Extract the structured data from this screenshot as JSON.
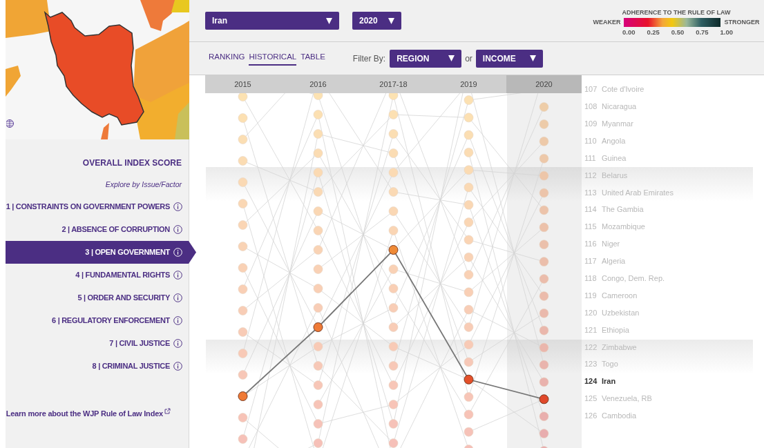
{
  "sidebar": {
    "overall": "OVERALL INDEX SCORE",
    "subtitle": "Explore by Issue/Factor",
    "factors": [
      {
        "label": "1 | CONSTRAINTS ON GOVERNMENT POWERS",
        "selected": false
      },
      {
        "label": "2 | ABSENCE OF CORRUPTION",
        "selected": false
      },
      {
        "label": "3 | OPEN GOVERNMENT",
        "selected": true
      },
      {
        "label": "4 | FUNDAMENTAL RIGHTS",
        "selected": false
      },
      {
        "label": "5 | ORDER AND SECURITY",
        "selected": false
      },
      {
        "label": "6 | REGULATORY ENFORCEMENT",
        "selected": false
      },
      {
        "label": "7 | CIVIL JUSTICE",
        "selected": false
      },
      {
        "label": "8 | CRIMINAL JUSTICE",
        "selected": false
      }
    ],
    "learn_more": "Learn more about the WJP Rule of Law Index"
  },
  "toolbar": {
    "country": "Iran",
    "year": "2020"
  },
  "legend": {
    "title": "ADHERENCE TO THE RULE OF LAW",
    "low_label": "WEAKER",
    "high_label": "STRONGER",
    "ticks": [
      "0.00",
      "0.25",
      "0.50",
      "0.75",
      "1.00"
    ]
  },
  "views": [
    {
      "label": "RANKING",
      "selected": false
    },
    {
      "label": "HISTORICAL",
      "selected": true
    },
    {
      "label": "TABLE",
      "selected": false
    }
  ],
  "filter": {
    "label": "Filter By:",
    "region": "REGION",
    "or": "or",
    "income": "INCOME"
  },
  "columns": [
    {
      "label": "2015",
      "selected": false
    },
    {
      "label": "2016",
      "selected": false
    },
    {
      "label": "2017-18",
      "selected": false
    },
    {
      "label": "2019",
      "selected": false
    },
    {
      "label": "2020",
      "selected": true
    }
  ],
  "ranking": [
    {
      "rank": "107",
      "country": "Cote d'Ivoire",
      "selected": false
    },
    {
      "rank": "108",
      "country": "Nicaragua",
      "selected": false
    },
    {
      "rank": "109",
      "country": "Myanmar",
      "selected": false
    },
    {
      "rank": "110",
      "country": "Angola",
      "selected": false
    },
    {
      "rank": "111",
      "country": "Guinea",
      "selected": false
    },
    {
      "rank": "112",
      "country": "Belarus",
      "selected": false
    },
    {
      "rank": "113",
      "country": "United Arab Emirates",
      "selected": false
    },
    {
      "rank": "114",
      "country": "The Gambia",
      "selected": false
    },
    {
      "rank": "115",
      "country": "Mozambique",
      "selected": false
    },
    {
      "rank": "116",
      "country": "Niger",
      "selected": false
    },
    {
      "rank": "117",
      "country": "Algeria",
      "selected": false
    },
    {
      "rank": "118",
      "country": "Congo, Dem. Rep.",
      "selected": false
    },
    {
      "rank": "119",
      "country": "Cameroon",
      "selected": false
    },
    {
      "rank": "120",
      "country": "Uzbekistan",
      "selected": false
    },
    {
      "rank": "121",
      "country": "Ethiopia",
      "selected": false
    },
    {
      "rank": "122",
      "country": "Zimbabwe",
      "selected": false
    },
    {
      "rank": "123",
      "country": "Togo",
      "selected": false
    },
    {
      "rank": "124",
      "country": "Iran",
      "selected": true
    },
    {
      "rank": "125",
      "country": "Venezuela, RB",
      "selected": false
    },
    {
      "rank": "126",
      "country": "Cambodia",
      "selected": false
    }
  ]
}
